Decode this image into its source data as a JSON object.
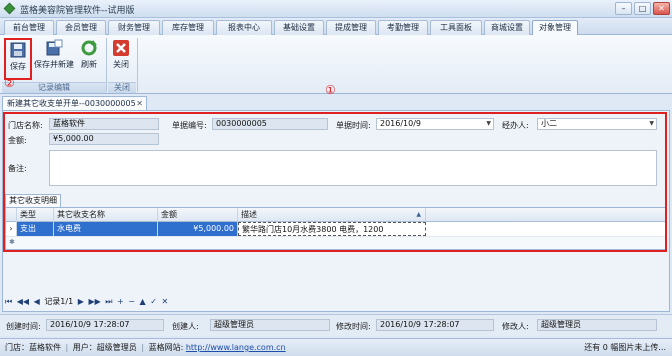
{
  "window": {
    "title": "蓝格美容院管理软件--试用版",
    "minimize": "–",
    "maximize": "□",
    "close": "✕"
  },
  "menu": {
    "tabs": [
      "前台管理",
      "会员管理",
      "财务管理",
      "库存管理",
      "报表中心",
      "基础设置",
      "提成管理",
      "考勤管理",
      "工具面板",
      "商城设置",
      "对象管理"
    ],
    "active_index": 10
  },
  "ribbon": {
    "save": "保存",
    "save_new": "保存并新建",
    "refresh": "刷新",
    "close": "关闭",
    "group_edit": "记录编辑",
    "group_close": "关闭"
  },
  "markers": {
    "one": "①",
    "two": "②"
  },
  "doc_tab": {
    "label": "新建其它收支单开单--0030000005",
    "close": "✕"
  },
  "form": {
    "store_label": "门店名称:",
    "store_value": "蓝格软件",
    "order_no_label": "单据编号:",
    "order_no_value": "0030000005",
    "order_time_label": "单据时间:",
    "order_time_value": "2016/10/9",
    "handler_label": "经办人:",
    "handler_value": "小二",
    "amount_label": "金额:",
    "amount_value": "¥5,000.00",
    "remark_label": "备注:",
    "remark_value": ""
  },
  "detail": {
    "tab_label": "其它收支明细",
    "columns": [
      "类型",
      "其它收支名称",
      "金额",
      "描述"
    ],
    "rows": [
      {
        "type": "支出",
        "name": "水电费",
        "amount": "¥5,000.00",
        "desc": "繁华路门店10月水费3800 电费，1200"
      }
    ]
  },
  "navigator": {
    "first": "⏮",
    "prev_page": "◀◀",
    "prev": "◀",
    "record": "记录1/1",
    "next": "▶",
    "next_page": "▶▶",
    "last": "⏭",
    "add": "+",
    "remove": "−",
    "edit": "▲",
    "confirm": "✓",
    "cancel": "✕"
  },
  "footer": {
    "created_time_label": "创建时间:",
    "created_time_value": "2016/10/9 17:28:07",
    "creator_label": "创建人:",
    "creator_value": "超级管理员",
    "modified_time_label": "修改时间:",
    "modified_time_value": "2016/10/9 17:28:07",
    "modifier_label": "修改人:",
    "modifier_value": "超级管理员"
  },
  "status": {
    "store": "门店：蓝格软件",
    "user": "用户：超级管理员",
    "site_label": "蓝格网站:",
    "site_url": "http://www.lange.com.cn",
    "right": "还有 0 幅图片未上传..."
  }
}
